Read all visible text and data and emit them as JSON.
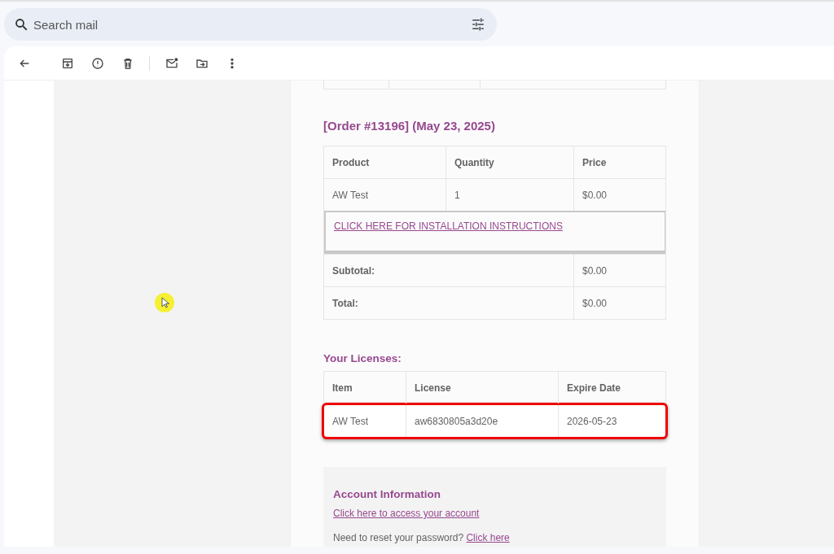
{
  "search": {
    "placeholder": "Search mail"
  },
  "email": {
    "order_heading": "[Order #13196] (May 23, 2025)",
    "order_table": {
      "columns": [
        "Product",
        "Quantity",
        "Price"
      ],
      "rows": [
        [
          "AW Test",
          "1",
          "$0.00"
        ]
      ],
      "link": "CLICK HERE FOR INSTALLATION INSTRUCTIONS",
      "totals": [
        {
          "label": "Subtotal:",
          "value": "$0.00"
        },
        {
          "label": "Total:",
          "value": "$0.00"
        }
      ]
    },
    "licenses_heading": "Your Licenses:",
    "licenses_table": {
      "columns": [
        "Item",
        "License",
        "Expire Date"
      ],
      "rows": [
        {
          "cells": [
            "AW Test",
            "aw6830805a3d20e",
            "2026-05-23"
          ],
          "highlighted": true
        }
      ]
    },
    "account": {
      "heading": "Account Information",
      "link": "Click here to access your account",
      "reset_text": "Need to reset your password?",
      "reset_link": "Click here"
    }
  }
}
